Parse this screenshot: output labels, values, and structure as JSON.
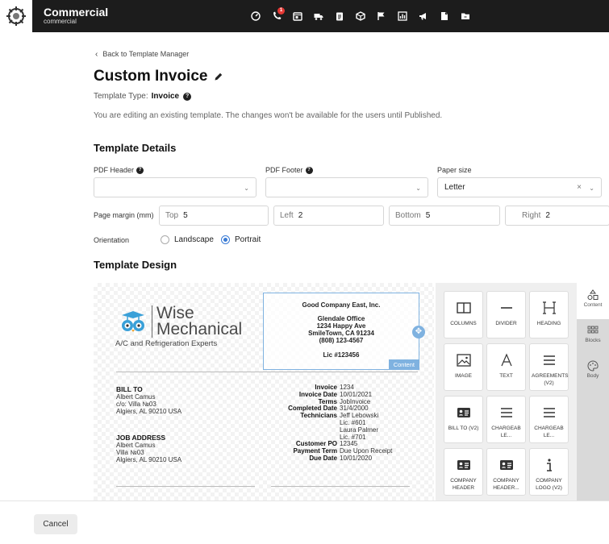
{
  "app": {
    "name": "Commercial",
    "subtitle": "commercial"
  },
  "topbar": {
    "icons": [
      "dashboard-icon",
      "phone-icon",
      "calendar-icon",
      "truck-icon",
      "clipboard-icon",
      "box-icon",
      "flag-icon",
      "chart-icon",
      "megaphone-icon",
      "file-icon",
      "folder-icon"
    ],
    "phone_badge": "1"
  },
  "back_link": "Back to Template Manager",
  "title": "Custom Invoice",
  "template_type": {
    "label": "Template Type:",
    "value": "Invoice"
  },
  "edit_note": "You are editing an existing template. The changes won't be available for the users until Published.",
  "details": {
    "heading": "Template Details",
    "pdf_header_label": "PDF Header",
    "pdf_header_value": "",
    "pdf_footer_label": "PDF Footer",
    "pdf_footer_value": "",
    "paper_size_label": "Paper size",
    "paper_size_value": "Letter",
    "page_margin_label": "Page margin (mm)",
    "margins": {
      "top_label": "Top",
      "top": "5",
      "left_label": "Left",
      "left": "2",
      "bottom_label": "Bottom",
      "bottom": "5",
      "right_label": "Right",
      "right": "2"
    },
    "orientation_label": "Orientation",
    "orientation_options": [
      "Landscape",
      "Portrait"
    ],
    "orientation_selected": "Portrait"
  },
  "design": {
    "heading": "Template Design",
    "logo": {
      "line1": "Wise",
      "line2": "Mechanical",
      "tagline": "A/C and Refrigeration Experts"
    },
    "company": {
      "name": "Good Company East, Inc.",
      "office": "Glendale Office",
      "street": "1234 Happy Ave",
      "city": "SmileTown, CA 91234",
      "phone": "(808) 123-4567",
      "license": "Lic #123456"
    },
    "content_tag": "Content",
    "bill_to": {
      "heading": "BILL TO",
      "lines": [
        "Albert Camus",
        "c/o: Villa №03",
        "Algiers, AL 90210 USA"
      ]
    },
    "job_address": {
      "heading": "JOB ADDRESS",
      "lines": [
        "Albert Camus",
        "Villa №03",
        "Algiers, AL 90210 USA"
      ]
    },
    "invoice_fields": [
      {
        "k": "Invoice",
        "v": "1234"
      },
      {
        "k": "Invoice Date",
        "v": "10/01/2021"
      },
      {
        "k": "Terms",
        "v": "JobInvoice"
      },
      {
        "k": "Completed Date",
        "v": "31/4/2000"
      },
      {
        "k": "Technicians",
        "v": "Jeff Lebowski"
      },
      {
        "k": "",
        "v": "Lic. #601"
      },
      {
        "k": "",
        "v": "Laura Palmer"
      },
      {
        "k": "",
        "v": "Lic. #701"
      },
      {
        "k": "Customer PO",
        "v": "12345"
      },
      {
        "k": "Payment Term",
        "v": "Due Upon Receipt"
      },
      {
        "k": "Due Date",
        "v": "10/01/2020"
      }
    ]
  },
  "palette": {
    "tiles": [
      {
        "label": "COLUMNS",
        "icon": "columns-icon"
      },
      {
        "label": "DIVIDER",
        "icon": "divider-icon"
      },
      {
        "label": "HEADING",
        "icon": "heading-icon"
      },
      {
        "label": "IMAGE",
        "icon": "image-icon"
      },
      {
        "label": "TEXT",
        "icon": "text-icon"
      },
      {
        "label": "AGREEMENTS (V2)",
        "icon": "agreements-icon"
      },
      {
        "label": "BILL TO (V2)",
        "icon": "contact-card-icon"
      },
      {
        "label": "CHARGEAB LE...",
        "icon": "list-icon"
      },
      {
        "label": "CHARGEAB LE...",
        "icon": "list-icon"
      },
      {
        "label": "COMPANY HEADER",
        "icon": "contact-card-icon"
      },
      {
        "label": "COMPANY HEADER...",
        "icon": "contact-card-icon"
      },
      {
        "label": "COMPANY LOGO (V2)",
        "icon": "info-icon"
      }
    ]
  },
  "rail": {
    "items": [
      "Content",
      "Blocks",
      "Body"
    ]
  },
  "footer": {
    "cancel": "Cancel"
  }
}
